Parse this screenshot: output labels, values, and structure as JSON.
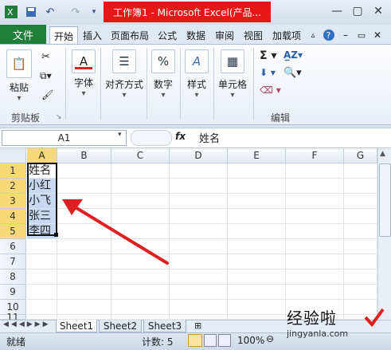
{
  "window": {
    "title": "工作簿1 - Microsoft Excel(产品..."
  },
  "qat": {
    "app_icon": "excel-icon",
    "save_icon": "save-icon",
    "undo_icon": "undo-icon",
    "redo_icon": "redo-icon"
  },
  "ribbon": {
    "file_tab": "文件",
    "tabs": [
      "开始",
      "插入",
      "页面布局",
      "公式",
      "数据",
      "审阅",
      "视图",
      "加载项"
    ],
    "active_tab": "开始",
    "groups": {
      "clipboard": {
        "paste": "粘贴",
        "label": "剪贴板"
      },
      "font": {
        "label": "字体"
      },
      "alignment": {
        "label": "对齐方式"
      },
      "number": {
        "label": "数字"
      },
      "styles": {
        "label": "样式"
      },
      "cells": {
        "label": "单元格"
      },
      "editing": {
        "label": "编辑"
      }
    }
  },
  "formula_bar": {
    "name_box": "A1",
    "fx": "fx",
    "content": "姓名"
  },
  "grid": {
    "columns": [
      "A",
      "B",
      "C",
      "D",
      "E",
      "F",
      "G"
    ],
    "rows": [
      "1",
      "2",
      "3",
      "4",
      "5",
      "6",
      "7",
      "8",
      "9",
      "10",
      "11"
    ],
    "cells": {
      "A1": "姓名",
      "A2": "小红",
      "A3": "小飞",
      "A4": "张三",
      "A5": "李四"
    }
  },
  "sheets": {
    "tabs": [
      "Sheet1",
      "Sheet2",
      "Sheet3"
    ],
    "active": "Sheet1"
  },
  "status": {
    "ready": "就绪",
    "count": "计数: 5",
    "zoom": "100%"
  },
  "watermark": "经验啦",
  "colors": {
    "excel_green": "#1e7e3a",
    "title_highlight": "#e51717",
    "selection_fill": "#c6d9f1",
    "header_selected": "#f7d979",
    "arrow_red": "#e02020"
  }
}
